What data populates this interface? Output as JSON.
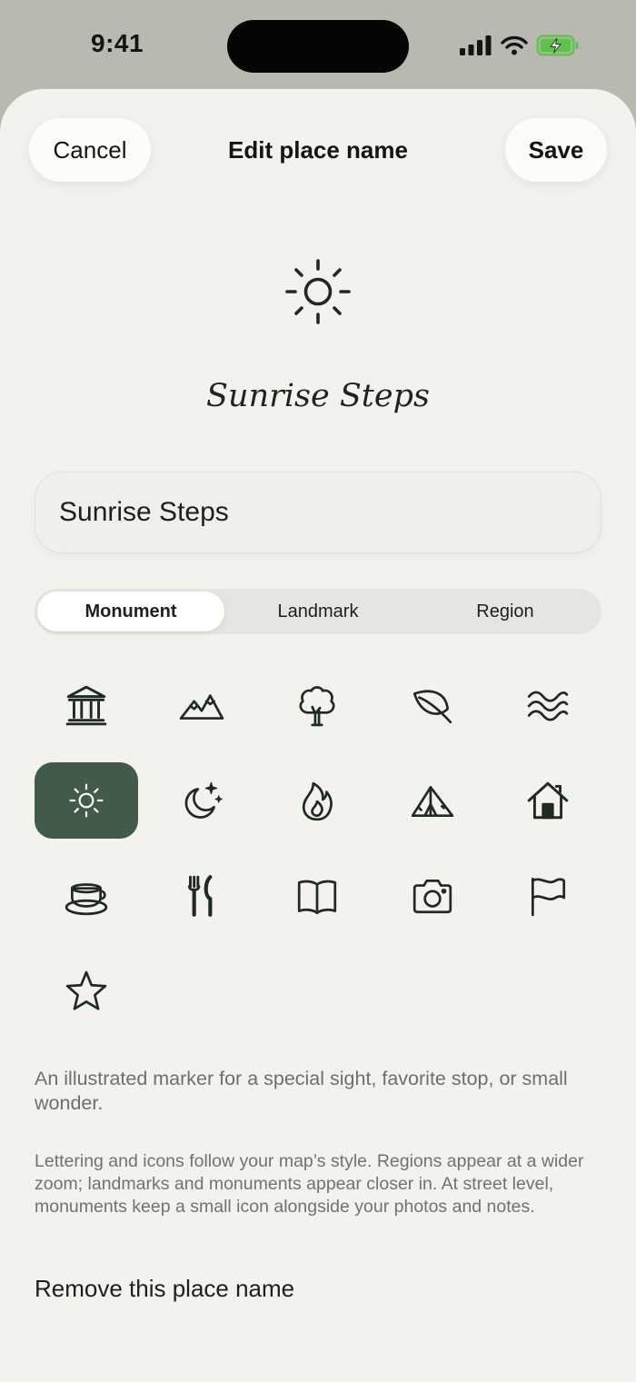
{
  "status_bar": {
    "time": "9:41",
    "icons": [
      "cellular-signal-icon",
      "wifi-icon",
      "battery-charging-icon"
    ]
  },
  "header": {
    "cancel_label": "Cancel",
    "title": "Edit place name",
    "save_label": "Save"
  },
  "preview": {
    "icon": "sun-icon",
    "name": "Sunrise Steps"
  },
  "name_field": {
    "value": "Sunrise Steps"
  },
  "segments": [
    "Monument",
    "Landmark",
    "Region"
  ],
  "selected_segment": "Monument",
  "icons": [
    "bank-icon",
    "mountains-icon",
    "tree-icon",
    "leaf-icon",
    "waves-icon",
    "sun-icon",
    "moon-stars-icon",
    "flame-icon",
    "tent-icon",
    "house-icon",
    "teacup-icon",
    "fork-knife-icon",
    "book-icon",
    "camera-icon",
    "flag-icon",
    "star-icon"
  ],
  "selected_icon": "sun-icon",
  "description": "An illustrated marker for a special sight, favorite stop, or small wonder.",
  "note": "Lettering and icons follow your map’s style. Regions appear at a wider zoom; landmarks and monuments appear closer in. At street level, monuments keep a small icon alongside your photos and notes.",
  "remove_label": "Remove this place name",
  "colors": {
    "accent": "#425a49",
    "sheet": "#f3f2ed",
    "icon_ink": "#1f2a22",
    "battery": "#5ec24a"
  }
}
